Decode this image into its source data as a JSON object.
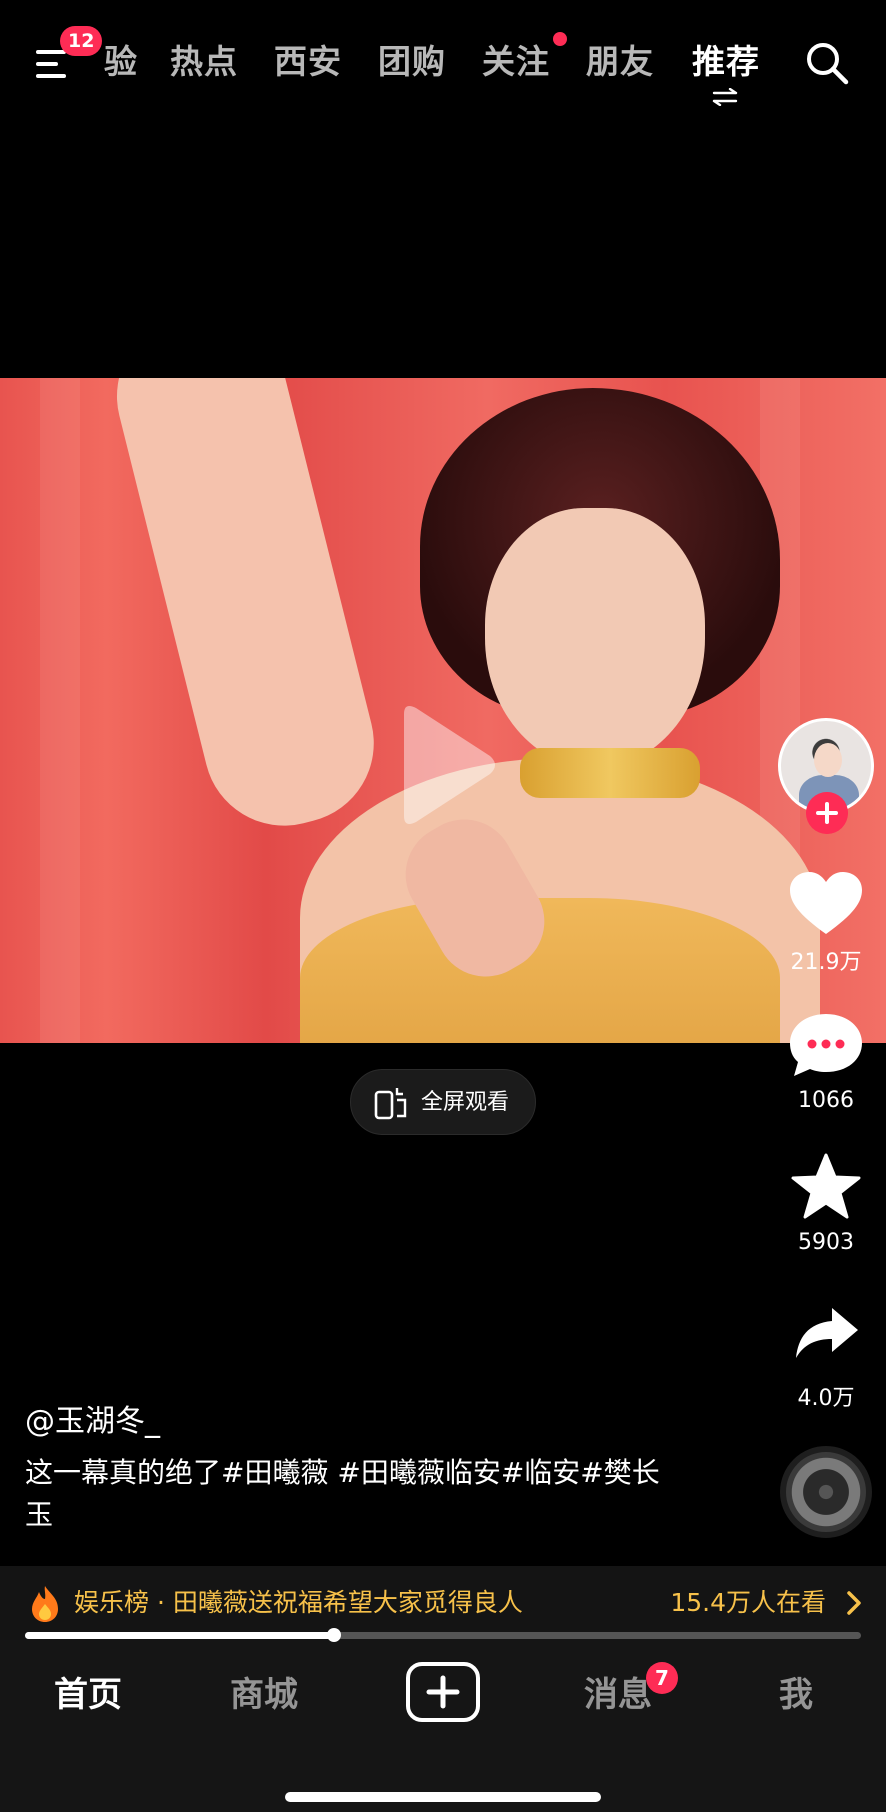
{
  "top_nav": {
    "menu_badge": "12",
    "tabs": [
      {
        "label": "验"
      },
      {
        "label": "热点"
      },
      {
        "label": "西安"
      },
      {
        "label": "团购"
      },
      {
        "label": "关注"
      },
      {
        "label": "朋友"
      },
      {
        "label": "推荐"
      }
    ],
    "active_tab": "推荐",
    "icons": {
      "menu": "menu-icon",
      "search": "search-icon",
      "swap": "swap-arrows-icon"
    }
  },
  "video": {
    "fullscreen_label": "全屏观看"
  },
  "side_rail": {
    "likes": "21.9万",
    "comments": "1066",
    "favorites": "5903",
    "shares": "4.0万"
  },
  "caption": {
    "author": "@玉湖冬_",
    "description": "这一幕真的绝了#田曦薇 #田曦薇临安#临安#樊长玉"
  },
  "hot_bar": {
    "text": "娱乐榜 · 田曦薇送祝福希望大家觅得良人",
    "count": "15.4万人在看"
  },
  "playback": {
    "progress": 0.37
  },
  "bottom_nav": {
    "home": "首页",
    "mall": "商城",
    "messages": "消息",
    "messages_badge": "7",
    "me": "我"
  },
  "colors": {
    "accent": "#fe2c55",
    "hot_text": "#f7c14a",
    "background": "#000000"
  }
}
